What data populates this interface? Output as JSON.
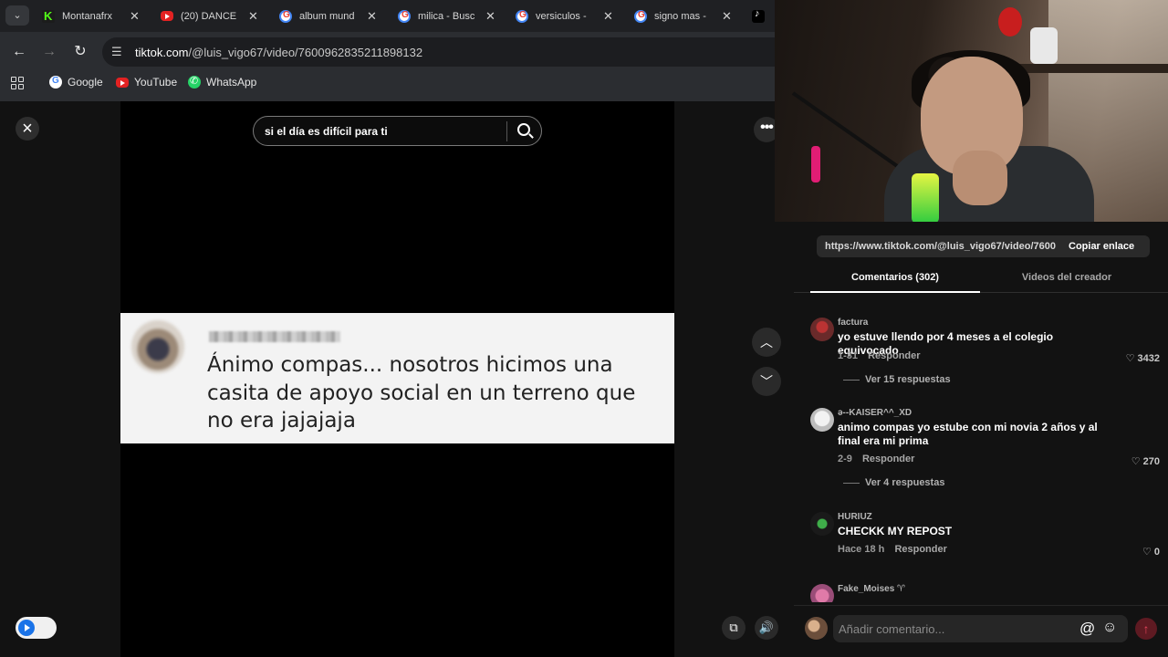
{
  "browser": {
    "tabs": [
      {
        "title": "Montanafrx",
        "favicon": "kick-icon"
      },
      {
        "title": "(20) DANCE",
        "favicon": "youtube-icon"
      },
      {
        "title": "album mund",
        "favicon": "google-icon"
      },
      {
        "title": "milica - Busc",
        "favicon": "google-icon"
      },
      {
        "title": "versiculos - ",
        "favicon": "google-icon"
      },
      {
        "title": "signo mas - ",
        "favicon": "google-icon"
      },
      {
        "title": "",
        "favicon": "tiktok-icon"
      }
    ],
    "url_domain": "tiktok.com",
    "url_path": "/@luis_vigo67/video/7600962835211898132",
    "bookmarks": [
      "Google",
      "YouTube",
      "WhatsApp"
    ]
  },
  "viewer": {
    "search_query": "si el día es difícil para ti",
    "overlay_text": "Ánimo compas... nosotros hicimos una casita de apoyo social en un terreno que no era jajajaja"
  },
  "panel": {
    "share_link": "https://www.tiktok.com/@luis_vigo67/video/76009...",
    "copy_label": "Copiar enlace",
    "tab_comments": "Comentarios (302)",
    "tab_creator": "Videos del creador",
    "comments": [
      {
        "user": "factura",
        "text": "yo estuve llendo por 4 meses a el colegio equivocado",
        "date": "1-31",
        "reply": "Responder",
        "likes": "3432",
        "replies": "Ver 15 respuestas"
      },
      {
        "user": "ə--KAISER^^_XD",
        "text": "animo compas yo estube con mi novia 2 años y al final era mi prima",
        "date": "2-9",
        "reply": "Responder",
        "likes": "270",
        "replies": "Ver 4 respuestas"
      },
      {
        "user": "HURIUZ",
        "text": "CHECKK MY REPOST",
        "date": "Hace 18 h",
        "reply": "Responder",
        "likes": "0"
      },
      {
        "user": "Fake_Moises ♈",
        "text": "",
        "date": "",
        "reply": "",
        "likes": ""
      }
    ],
    "input_placeholder": "Añadir comentario..."
  }
}
